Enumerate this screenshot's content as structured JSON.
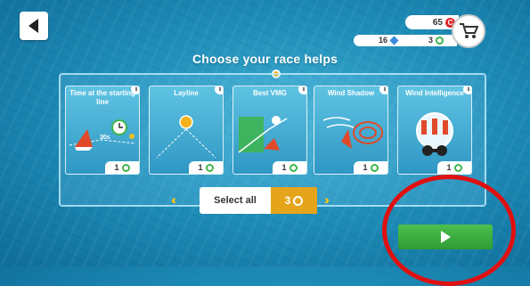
{
  "header": {
    "back_icon": "back-arrow-icon"
  },
  "currency": {
    "coins": "65",
    "coin_symbol": "C",
    "gems": "16",
    "tokens": "3",
    "coin_color": "#e0262b"
  },
  "title": "Choose your race helps",
  "helps": [
    {
      "label": "Time at the starting line",
      "cost": "1",
      "art": "starting-line-icon",
      "art_text": "30s"
    },
    {
      "label": "Layline",
      "cost": "1",
      "art": "layline-icon"
    },
    {
      "label": "Best VMG",
      "cost": "1",
      "art": "vmg-icon"
    },
    {
      "label": "Wind Shadow",
      "cost": "1",
      "art": "wind-shadow-icon"
    },
    {
      "label": "Wind Intelligence",
      "cost": "1",
      "art": "wind-intelligence-icon"
    }
  ],
  "select_all": {
    "label": "Select all",
    "cost": "3"
  },
  "info_glyph": "i",
  "colors": {
    "accent": "#f3c11b",
    "play": "#3db54a",
    "highlight": "#e01010"
  }
}
